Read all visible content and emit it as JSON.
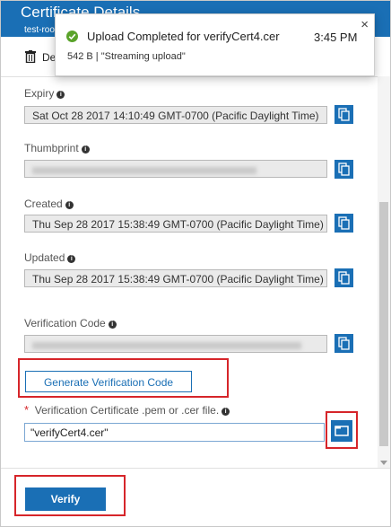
{
  "header": {
    "title": "Certificate Details",
    "subtitle": "test-roo"
  },
  "toolbar": {
    "delete_label": "De",
    "delete_icon": "trash-icon"
  },
  "toast": {
    "title": "Upload Completed for verifyCert4.cer",
    "time": "3:45 PM",
    "detail": "542 B | \"Streaming upload\"",
    "close_glyph": "×",
    "status_color": "#5aa32a"
  },
  "fields": {
    "expiry": {
      "label": "Expiry",
      "value": "Sat Oct 28 2017 14:10:49 GMT-0700 (Pacific Daylight Time)"
    },
    "thumbprint": {
      "label": "Thumbprint",
      "value": ""
    },
    "created": {
      "label": "Created",
      "value": "Thu Sep 28 2017 15:38:49 GMT-0700 (Pacific Daylight Time)"
    },
    "updated": {
      "label": "Updated",
      "value": "Thu Sep 28 2017 15:38:49 GMT-0700 (Pacific Daylight Time)"
    },
    "verification_code": {
      "label": "Verification Code",
      "value": ""
    }
  },
  "generate_button": {
    "label": "Generate Verification Code"
  },
  "upload": {
    "required_mark": "*",
    "label": "Verification Certificate .pem or .cer file.",
    "value": "\"verifyCert4.cer\""
  },
  "verify_button": {
    "label": "Verify"
  },
  "colors": {
    "accent": "#1a6fb5",
    "highlight_outline": "#d6252a"
  }
}
